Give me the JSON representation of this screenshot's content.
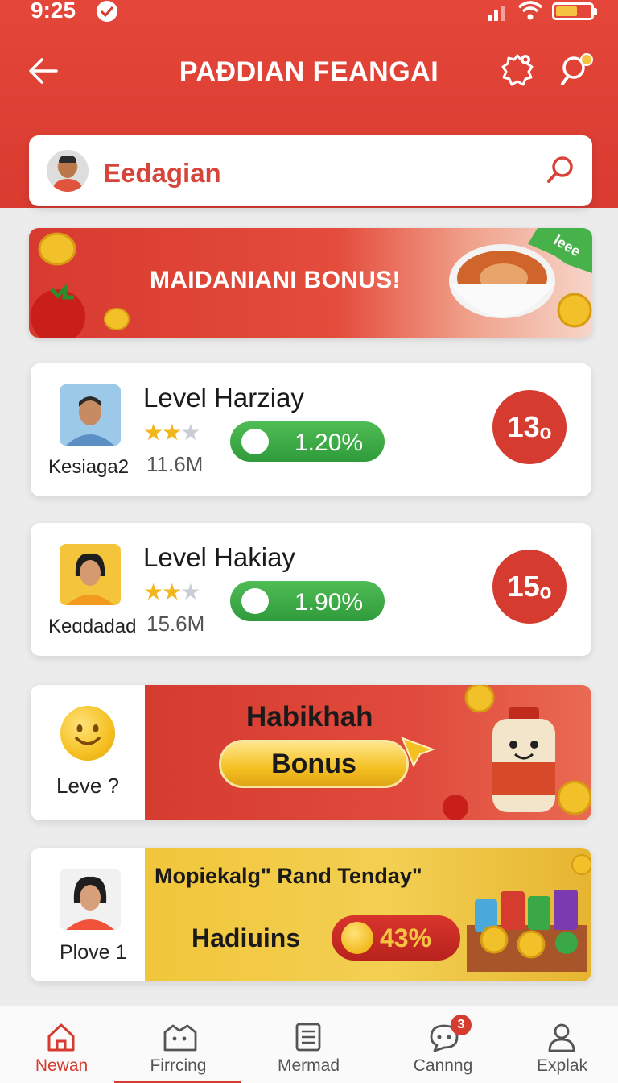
{
  "status_bar": {
    "time": "9:25"
  },
  "header": {
    "title": "PAƉDIAN FEANGAI"
  },
  "search": {
    "value": "Eedagian"
  },
  "promo": {
    "text": "MAIDANIANI BONUS!",
    "tag": "leee"
  },
  "levels": [
    {
      "title": "Level Harziay",
      "user": "Kesiaga2",
      "rating": 2,
      "count": "11.6M",
      "percent": "1.20%",
      "rank": "13ₒ"
    },
    {
      "title": "Level Hakiay",
      "user": "Keɑdadad",
      "rating": 2,
      "count": "15.6M",
      "percent": "1.90%",
      "rank": "15ₒ"
    }
  ],
  "bonus_card": {
    "left_label": "Leve ?",
    "heading": "Habikhah",
    "button": "Bonus"
  },
  "tender_card": {
    "left_label": "Plove 1",
    "heading": "Mopiekalg\" Rand Tenday\"",
    "label": "Hadiuins",
    "percent": "43%"
  },
  "tabs": [
    {
      "label": "Newan",
      "icon": "home-icon",
      "active": true
    },
    {
      "label": "Firrcing",
      "icon": "grid-icon",
      "active": false
    },
    {
      "label": "Mermad",
      "icon": "list-icon",
      "active": false
    },
    {
      "label": "Cannng",
      "icon": "chat-icon",
      "active": false,
      "badge": "3"
    },
    {
      "label": "Explak",
      "icon": "profile-icon",
      "active": false
    }
  ],
  "colors": {
    "primary": "#d63b30",
    "green": "#3aa846",
    "gold": "#f5c242"
  }
}
